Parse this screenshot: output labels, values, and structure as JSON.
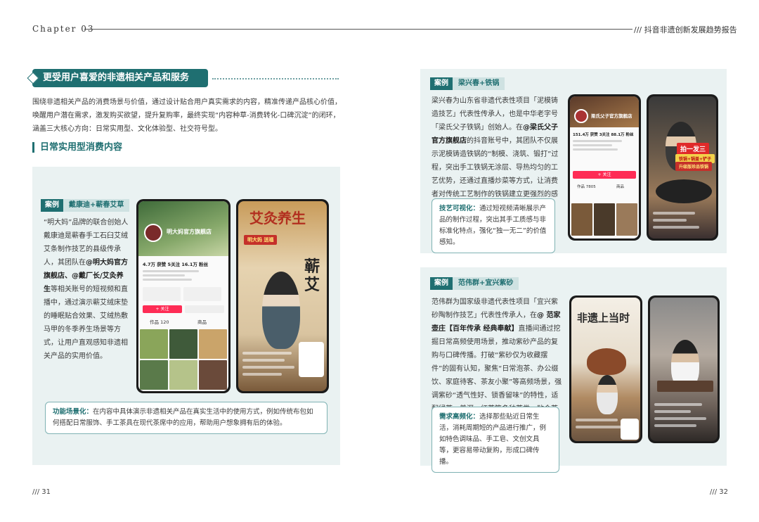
{
  "header": {
    "chapter": "Chapter 03",
    "report_title": "/// 抖音非遗创新发展趋势报告"
  },
  "section": {
    "title": "更受用户喜爱的非遗相关产品和服务",
    "intro": "围绕非遗相关产品的消费场景与价值，通过设计贴合用户真实需求的内容，精准传递产品核心价值，唤醒用户潜在需求，激发购买欲望，提升复购率，最终实现“内容种草-消费转化-口碑沉淀”的闭环，涵盖三大核心方向：日常实用型、文化体验型、社交符号型。",
    "subtitle": "日常实用型消费内容"
  },
  "case1": {
    "tag": "案例",
    "name": "戴康迪+蕲春艾草",
    "text_a": "“明大妈”品牌的联合创始人戴康迪是蕲春手工石臼艾绒艾条制作技艺的县级传承人，其团队在",
    "text_bold": "@明大妈官方旗舰店、@戴厂长/艾灸养生",
    "text_b": "等相关账号的短视频和直播中，通过演示蕲艾绒床垫的睡眠贴合效果、艾绒热敷马甲的冬季养生场景等方式，让用户直观感知非遗相关产品的实用价值。",
    "note_key": "功能场景化：",
    "note_text": "在内容中具体演示非遗相关产品在真实生活中的使用方式，例如传统布包如何搭配日常服饰、手工茶具在现代茶席中的应用，帮助用户想象拥有后的体验。",
    "phone1": {
      "shop": "明大妈官方旗舰店",
      "stats": "4.7万 获赞  5关注  16.1万 粉丝",
      "follow": "+ 关注",
      "tabs": [
        "作品 120",
        "商品"
      ]
    },
    "phone2": {
      "banner": "明大妈 送福",
      "big": "蕲艾",
      "live_title": "艾灸养生"
    }
  },
  "case2": {
    "tag": "案例",
    "name": "梁兴春+铁锅",
    "text_a": "梁兴春为山东省非遗代表性项目「泥模铸造技艺」代表性传承人，也是中华老字号「梁氏父子铁锅」创始人。在",
    "text_bold": "@梁氏父子官方旗舰店",
    "text_b": "的抖音账号中，其团队不仅展示泥模铸造铁锅的“制模、浇筑、锻打”过程，突出手工铁锅无涂层、导热均匀的工艺优势，还通过直播炒菜等方式，让消费者对传统工艺制作的铁锅建立更强烈的感知。",
    "note_key": "技艺可视化：",
    "note_text": "通过短视频清晰展示产品的制作过程，突出其手工质感与非标准化特点，强化“独一无二”的价值感知。",
    "phone1": {
      "shop": "梁氏父子官方旗舰店",
      "stats": "151.4万 获赞  3关注  88.1万 粉丝",
      "follow": "+ 关注",
      "tabs": [
        "作品 7805",
        "商品"
      ]
    },
    "phone2": {
      "banner1": "拍一发三",
      "banner2": "铁锅+锅盖+铲子",
      "banner3": "升级版珍品铁锅"
    }
  },
  "case3": {
    "tag": "案例",
    "name": "范伟群+宜兴紫砂",
    "text_a": "范伟群为国家级非遗代表性项目「宜兴紫砂陶制作技艺」代表性传承人，在",
    "text_bold": "@ 范家壶庄【百年传承 经典奉献】",
    "text_b": "直播间通过挖掘日常高频使用场景，推动紫砂产品的复购与口碑传播。打破“紫砂仅为收藏摆件”的固有认知，聚焦“日常泡茶、办公缀饮、家庭待客、茶友小聚”等高频场景，强调紫砂“透气性好、锁香留味”的特性，适配绿茶、普洱、红茶等多种茶类，贴合茶友每日饮茶的需求。",
    "note_key": "需求高频化：",
    "note_text": "选择那些贴近日常生活，消耗周期短的产品进行推广，例如特色调味品、手工皂、文创文具等，更容易带动复购，形成口碑传播。",
    "phone1": {
      "big": "非遗上当时"
    },
    "phone2": {}
  },
  "footer": {
    "page_left": "/// 31",
    "page_right": "/// 32"
  },
  "colors": {
    "accent": "#1f6f71",
    "panel": "#eaf2f2",
    "douyin_red": "#fe2c55"
  }
}
